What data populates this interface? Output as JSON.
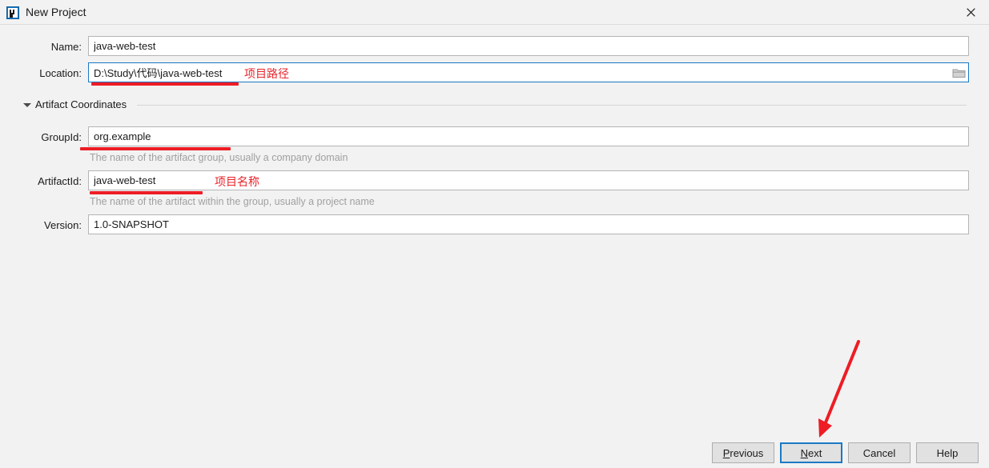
{
  "window": {
    "title": "New Project",
    "app_icon": "intellij-idea-icon",
    "close_icon": "close-icon"
  },
  "form": {
    "name": {
      "label": "Name:",
      "value": "java-web-test",
      "placeholder": ""
    },
    "location": {
      "label": "Location:",
      "value": "D:\\Study\\代码\\java-web-test",
      "placeholder": "",
      "browse_icon": "folder-icon",
      "focused": true
    }
  },
  "section": {
    "title": "Artifact Coordinates",
    "expanded": true,
    "toggle_icon": "chevron-down-icon",
    "fields": {
      "group_id": {
        "label": "GroupId:",
        "value": "org.example",
        "hint": "The name of the artifact group, usually a company domain"
      },
      "artifact_id": {
        "label": "ArtifactId:",
        "value": "java-web-test",
        "hint": "The name of the artifact within the group, usually a project name"
      },
      "version": {
        "label": "Version:",
        "value": "1.0-SNAPSHOT"
      }
    }
  },
  "annotations": {
    "location_note": "项目路径",
    "artifact_note": "项目名称",
    "arrow_color": "#ee1c25",
    "underline_color": "#ee1c25",
    "text_color": "#e8232a"
  },
  "buttons": {
    "previous": {
      "label": "Previous",
      "mnemonic": "P",
      "rest": "revious"
    },
    "next": {
      "label": "Next",
      "mnemonic": "N",
      "rest": "ext",
      "focused": true
    },
    "cancel": {
      "label": "Cancel"
    },
    "help": {
      "label": "Help"
    }
  },
  "colors": {
    "dialog_bg": "#f2f2f2",
    "field_bg": "#ffffff",
    "field_border": "#b5b5b5",
    "focus_blue": "#1b79c4",
    "hint_gray": "#a0a0a0",
    "button_bg": "#e1e1e1"
  }
}
